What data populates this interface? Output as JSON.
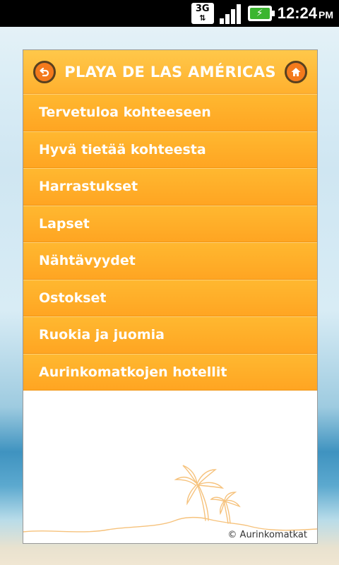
{
  "status_bar": {
    "network": "3G",
    "time": "12:24",
    "ampm": "PM"
  },
  "header": {
    "title": "PLAYA DE LAS AMÉRICAS",
    "back_icon": "back-arrow-icon",
    "home_icon": "home-icon"
  },
  "menu": {
    "items": [
      "Tervetuloa kohteeseen",
      "Hyvä tietää kohteesta",
      "Harrastukset",
      "Lapset",
      "Nähtävyydet",
      "Ostokset",
      "Ruokia ja juomia",
      "Aurinkomatkojen hotellit"
    ]
  },
  "footer": {
    "copyright": "© Aurinkomatkat"
  },
  "colors": {
    "accent": "#ffaa24",
    "button": "#f47a1c"
  }
}
